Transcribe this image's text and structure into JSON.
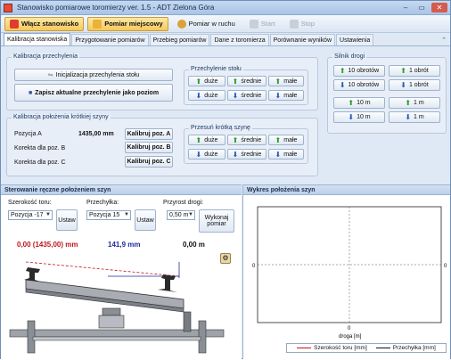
{
  "window": {
    "title": "Stanowisko pomiarowe toromierzy ver. 1.5 - ADT Zielona Góra",
    "controls": {
      "minimize": "–",
      "maximize": "▭",
      "close": "✕"
    }
  },
  "toolbar": {
    "buttons": [
      {
        "label": "Włącz stanowisko",
        "icon": "power-icon",
        "state": "active"
      },
      {
        "label": "Pomiar miejscowy",
        "icon": "measure-icon",
        "state": "active"
      },
      {
        "label": "Pomiar w ruchu",
        "icon": "motion-icon",
        "state": "normal"
      },
      {
        "label": "Start",
        "icon": "play-icon",
        "state": "disabled"
      },
      {
        "label": "Stop",
        "icon": "stop-icon",
        "state": "disabled"
      }
    ]
  },
  "tabs": [
    "Kalibracja stanowiska",
    "Przygotowanie pomiarów",
    "Przebieg pomiarów",
    "Dane z toromierza",
    "Porównanie wyników",
    "Ustawienia"
  ],
  "tabs_caret": "⌃",
  "calibration_tilt": {
    "title": "Kalibracja przechylenia",
    "init_button": "Inicjalizacja przechylenia stołu",
    "save_button": "Zapisz aktualne przechylenie jako poziom",
    "table_tilt": {
      "title": "Przechylenie stołu",
      "up": [
        "duże",
        "średnie",
        "małe"
      ],
      "down": [
        "duże",
        "średnie",
        "małe"
      ]
    }
  },
  "calibration_rail": {
    "title": "Kalibracja położenia krótkiej szyny",
    "position_a_label": "Pozycja A",
    "position_a_value": "1435,00 mm",
    "correction_b_label": "Korekta dla poz. B",
    "correction_c_label": "Korekta dla poz. C",
    "cal_a": "Kalibruj poz. A",
    "cal_b": "Kalibruj poz. B",
    "cal_c": "Kalibruj poz. C",
    "shift": {
      "title": "Przesuń krótką szynę",
      "up": [
        "duże",
        "średnie",
        "małe"
      ],
      "down": [
        "duże",
        "średnie",
        "małe"
      ]
    }
  },
  "motor": {
    "title": "Silnik drogi",
    "up": [
      "10 obrotów",
      "1 obrót"
    ],
    "down": [
      "10 obrotów",
      "1 obrót"
    ],
    "up_m": [
      "10 m",
      "1 m"
    ],
    "down_m": [
      "10 m",
      "1 m"
    ]
  },
  "manual": {
    "header": "Sterowanie ręczne położeniem szyn",
    "width_label": "Szerokość toru:",
    "width_value": "Pozycja -17",
    "tilt_label": "Przechyłka:",
    "tilt_value": "Pozycja 15",
    "increment_label": "Przyrost drogi:",
    "increment_value": "0,50 m",
    "set_button": "Ustaw",
    "set_button2": "Ustaw",
    "measure_button_line1": "Wykonaj",
    "measure_button_line2": "pomiar",
    "readout_width": "0,00 (1435,00) mm",
    "readout_tilt": "141,9 mm",
    "readout_distance": "0,00 m",
    "colors": {
      "width": "#c0141c",
      "tilt": "#1f2a9a",
      "distance": "#111111"
    }
  },
  "chart": {
    "header": "Wykres położenia szyn",
    "chart_data": {
      "type": "line",
      "title": "",
      "xlabel": "droga [m]",
      "ylabel": "",
      "x_tick": "0",
      "y_tick_left": "0",
      "y_tick_right": "0",
      "series": [
        {
          "name": "Szerokość toru [mm]",
          "color": "#c0141c",
          "values": []
        },
        {
          "name": "Przechyłka [mm]",
          "color": "#111111",
          "values": []
        }
      ],
      "legend": "bottom"
    }
  }
}
